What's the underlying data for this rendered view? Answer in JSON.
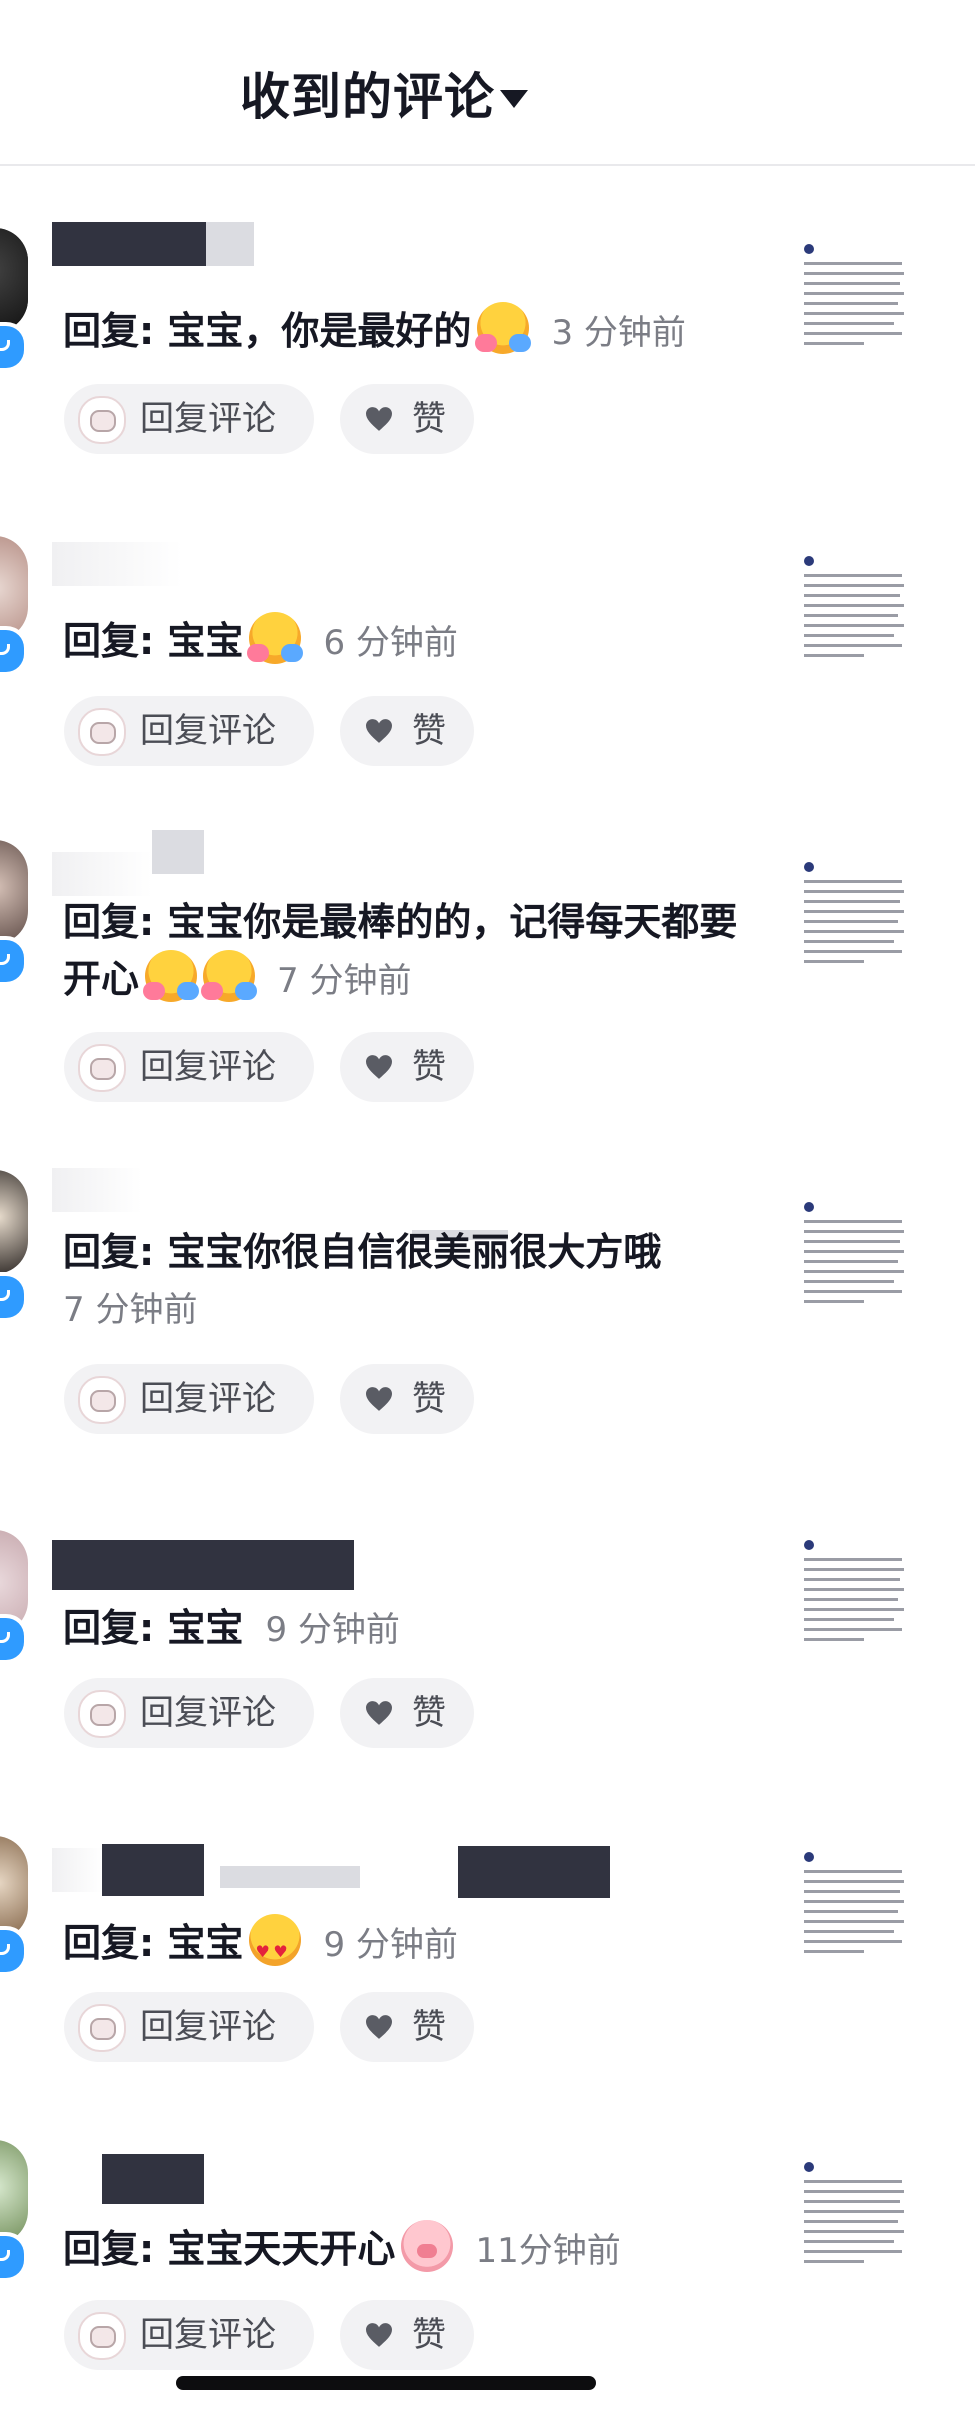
{
  "header": {
    "title": "收到的评论"
  },
  "actions": {
    "reply_label": "回复评论",
    "like_label": "赞"
  },
  "comments": [
    {
      "text": "回复: 宝宝，你是最好的",
      "emoji": "hug",
      "time": "3 分钟前"
    },
    {
      "text": "回复: 宝宝",
      "emoji": "hug",
      "time": "6 分钟前"
    },
    {
      "text": "回复: 宝宝你是最棒的的，记得每天都要开心",
      "emoji": "hug-hug",
      "time": "7 分钟前"
    },
    {
      "text": "回复: 宝宝你很自信很美丽很大方哦",
      "emoji": "",
      "time": "7 分钟前"
    },
    {
      "text": "回复: 宝宝",
      "emoji": "",
      "time": "9 分钟前"
    },
    {
      "text": "回复: 宝宝",
      "emoji": "heart-eyes",
      "time": "9 分钟前"
    },
    {
      "text": "回复: 宝宝天天开心",
      "emoji": "pig",
      "time": "11分钟前"
    }
  ]
}
